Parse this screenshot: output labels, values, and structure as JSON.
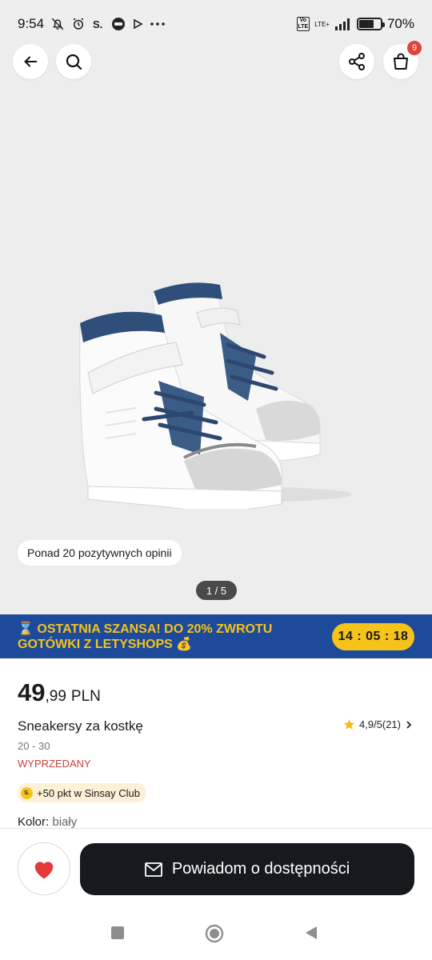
{
  "status_bar": {
    "time": "9:54",
    "battery": "70%",
    "battery_level": 0.7,
    "network_label": "LTE+"
  },
  "header": {
    "back_icon": "arrow-left-icon",
    "search_icon": "search-icon",
    "share_icon": "share-icon",
    "cart_icon": "shopping-bag-icon",
    "cart_count": "9"
  },
  "gallery": {
    "review_chip": "Ponad 20 pozytywnych opinii",
    "pager": "1 / 5"
  },
  "promo": {
    "text": "⌛ OSTATNIA SZANSA! DO 20% ZWROTU GOTÓWKI Z LETYSHOPS 💰",
    "timer": "14 : 05 : 18",
    "colors": {
      "background": "#1d4a9b",
      "accent": "#f5c319"
    }
  },
  "product": {
    "price_int": "49",
    "price_dec": ",99",
    "currency": "PLN",
    "name": "Sneakersy za kostkę",
    "rating": "4,9/5",
    "review_count": "(21)",
    "sizes": "20 - 30",
    "status": "WYPRZEDANY",
    "club_coin": "S.",
    "club_points": "+50 pkt w Sinsay Club",
    "color_label": "Kolor:",
    "color_value": "biały"
  },
  "actions": {
    "favorite_icon": "heart-icon",
    "notify_label": "Powiadom o dostępności",
    "notify_icon": "envelope-icon"
  },
  "colors": {
    "status_red": "#c9403c",
    "heart": "#e53a3a",
    "button_dark": "#161a1f"
  }
}
